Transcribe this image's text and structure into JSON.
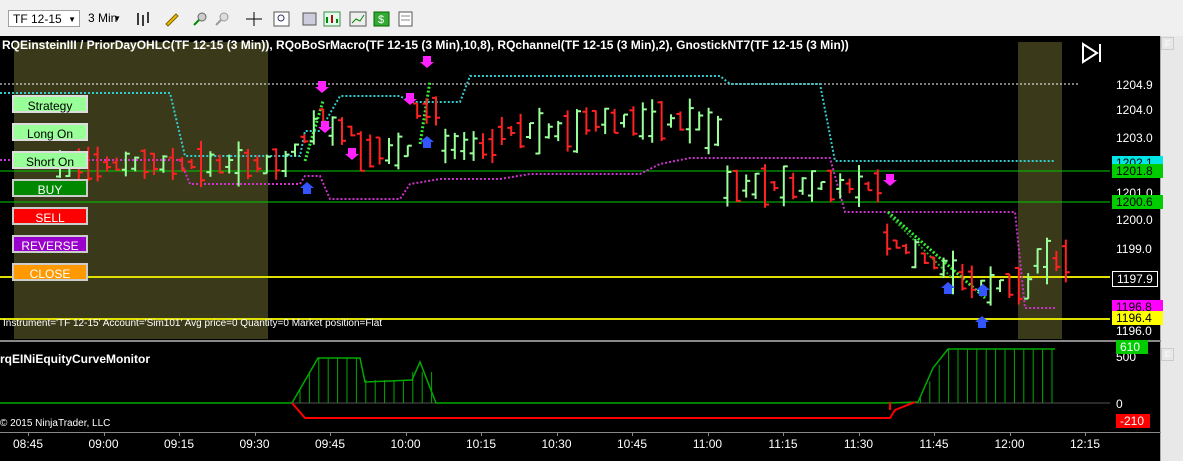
{
  "toolbar": {
    "instrument": "TF 12-15",
    "interval": "3 Min",
    "icons": [
      "bar-style-icon",
      "pencil-icon",
      "zoom-in-icon",
      "zoom-out-icon",
      "crosshair-icon",
      "find-icon",
      "properties-icon",
      "strategy-icon",
      "dollar-icon",
      "data-box-icon"
    ]
  },
  "chart": {
    "title": "RQEinsteinIII / PriorDayOHLC(TF 12-15 (3 Min)), RQoBoSrMacro(TF 12-15 (3 Min),10,8), RQchannel(TF 12-15 (3 Min),2), GnostickNT7(TF 12-15 (3 Min))",
    "info_line": "Instrument='TF 12-15' Account='Sim101' Avg price=0 Quantity=0 Market position=Flat",
    "f_button": "F",
    "price_axis": [
      "1204.9",
      "1204.0",
      "1203.0",
      "1201.0",
      "1200.0",
      "1199.0",
      "1197.9",
      "1196.0"
    ],
    "price_tags": [
      {
        "text": "1202.1",
        "bg": "#00e5e5",
        "fg": "#000"
      },
      {
        "text": "1201.8",
        "bg": "#00cc00",
        "fg": "#000"
      },
      {
        "text": "1200.6",
        "bg": "#00cc00",
        "fg": "#000"
      },
      {
        "text": "1196.8",
        "bg": "#ff00ff",
        "fg": "#000"
      },
      {
        "text": "1196.4",
        "bg": "#ffff00",
        "fg": "#000"
      }
    ]
  },
  "panel": {
    "strategy": "Strategy",
    "long_on": "Long On",
    "short_on": "Short On",
    "buy": "BUY",
    "sell": "SELL",
    "reverse": "REVERSE",
    "close": "CLOSE"
  },
  "subpanel": {
    "title": "rqEINiEquityCurveMonitor",
    "axis": [
      "500",
      "0"
    ],
    "tags": [
      {
        "text": "610",
        "bg": "#00cc00",
        "fg": "#fff"
      },
      {
        "text": "-210",
        "bg": "#ff0000",
        "fg": "#fff"
      }
    ],
    "f_button": "F"
  },
  "footer": {
    "copyright": "© 2015 NinjaTrader, LLC",
    "times": [
      "08:45",
      "09:00",
      "09:15",
      "09:30",
      "09:45",
      "10:00",
      "10:15",
      "10:30",
      "10:45",
      "11:00",
      "11:15",
      "11:30",
      "11:45",
      "12:00",
      "12:15"
    ]
  },
  "colors": {
    "bull": "#99ff99",
    "bear": "#ff2222",
    "cyan": "#33cccc",
    "magenta": "#cc33cc",
    "green_line": "#00cc00",
    "yellow": "#ffff00"
  }
}
